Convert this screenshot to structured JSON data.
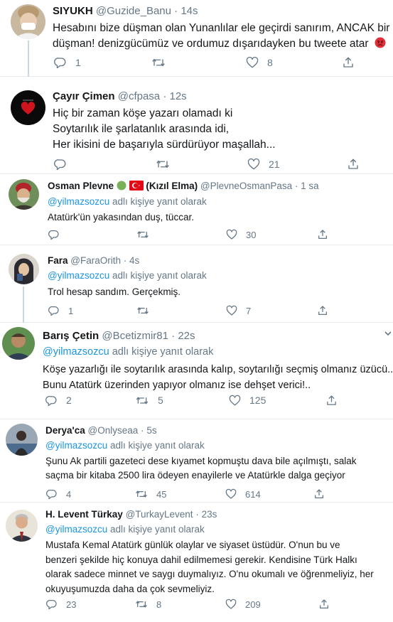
{
  "reply_context": {
    "mention": "@yilmazsozcu",
    "suffix": " adlı kişiye yanıt olarak"
  },
  "tweets": [
    {
      "name": "SIYUKH",
      "handle": "@Guzide_Banu",
      "sep": "·",
      "time": "14s",
      "lines": [
        "Hesabını bize düşman olan Yunanlılar ele geçirdi sanırım, ANCAK bir",
        "düşman! denizgücümüz ve ordumuz dışarıdayken bu tweete atar"
      ],
      "emoji": "angry-face-emoji",
      "reply_count": "1",
      "retweet_count": "",
      "like_count": "8"
    },
    {
      "name": "Çayır Çimen",
      "handle": "@cfpasa",
      "sep": "·",
      "time": "12s",
      "lines": [
        "Hiç bir zaman köşe yazarı olamadı ki",
        "Soytarılık ile şarlatanlık arasında idi,",
        "Her ikisini de başarıyla sürdürüyor maşallah..."
      ],
      "reply_count": "",
      "retweet_count": "",
      "like_count": "21"
    },
    {
      "name": "Osman Plevne",
      "badges": [
        "green-circle-emoji",
        "turkish-flag-emoji"
      ],
      "name_suffix": "(Kızıl Elma)",
      "handle": "@PlevneOsmanPasa",
      "sep": "·",
      "time": "1 sa",
      "lines": [
        "Atatürk'ün yakasından duş, tüccar."
      ],
      "reply_count": "",
      "retweet_count": "",
      "like_count": "30"
    },
    {
      "name": "Fara",
      "handle": "@FaraOrith",
      "sep": "·",
      "time": "4s",
      "lines": [
        "Trol hesap sandım. Gerçekmiş."
      ],
      "reply_count": "1",
      "retweet_count": "",
      "like_count": "7"
    },
    {
      "name": "Barış Çetin",
      "handle": "@Bcetizmir81",
      "sep": "·",
      "time": "22s",
      "lines": [
        "Köşe yazarlığı ile soytarılık arasında kalıp, soytarılığı seçmiş olmanız üzücü..",
        "Bunu Atatürk üzerinden yapıyor olmanız ise dehşet verici!.."
      ],
      "reply_count": "2",
      "retweet_count": "5",
      "like_count": "125"
    },
    {
      "name": "Derya'ca",
      "handle": "@Onlyseaa",
      "sep": "·",
      "time": "5s",
      "lines": [
        "Şunu Ak partili gazeteci dese kıyamet kopmuştu dava bile açılmıştı, salak",
        "saçma bir kitaba 2500 lira ödeyen enayilerle ve Atatürkle dalga geçiyor"
      ],
      "reply_count": "4",
      "retweet_count": "45",
      "like_count": "614"
    },
    {
      "name": "H. Levent Türkay",
      "handle": "@TurkayLevent",
      "sep": "·",
      "time": "23s",
      "lines": [
        "Mustafa Kemal Atatürk günlük olaylar ve siyaset üstüdür. O'nun bu ve",
        "benzeri şekilde hiç konuya dahil edilmemesi gerekir. Kendisine Türk Halkı",
        "olarak sadece minnet ve saygı duymalıyız. O'nu okumalı ve öğrenmeliyiz, her",
        "okuyuşumuzda daha da çok sevmeliyiz."
      ],
      "reply_count": "23",
      "retweet_count": "8",
      "like_count": "209"
    }
  ],
  "colors": {
    "text": "#14171a",
    "secondary": "#657786",
    "link": "#1b95e0",
    "divider": "#e6ecf0",
    "thread_line": "#ccd6dd"
  }
}
